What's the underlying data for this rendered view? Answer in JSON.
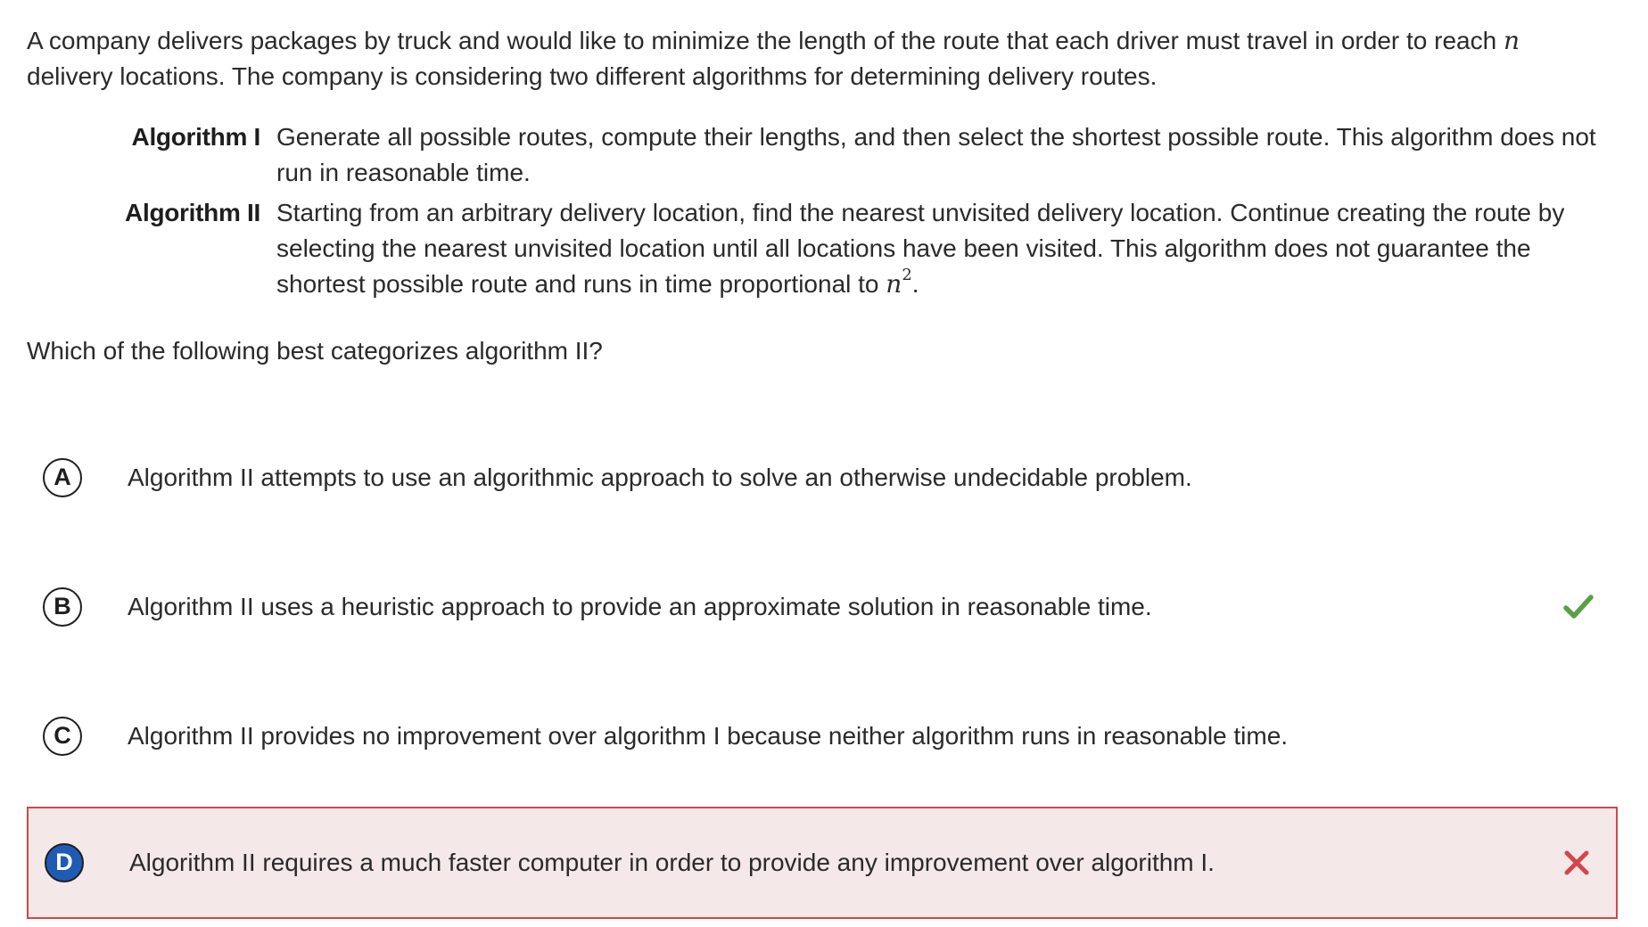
{
  "stem": {
    "line1_before": "A company delivers packages by truck and would like to minimize the length of the route that each driver must travel in order to reach ",
    "var_n": "n",
    "line2": "delivery locations. The company is considering two different algorithms for determining delivery routes."
  },
  "algorithms": [
    {
      "name": "Algorithm I",
      "description": "Generate all possible routes, compute their lengths, and then select the shortest possible route. This algorithm does not run in reasonable time."
    },
    {
      "name": "Algorithm II",
      "description": "Starting from an arbitrary delivery location, find the nearest unvisited delivery location. Continue creating the route by selecting the nearest unvisited location until all locations have been visited. This algorithm does not guarantee the shortest possible route and runs in time proportional to ",
      "math_base": "n",
      "math_exp": "2",
      "end": "."
    }
  ],
  "question": "Which of the following best categorizes algorithm II?",
  "choices": [
    {
      "letter": "A",
      "text": "Algorithm II attempts to use an algorithmic approach to solve an otherwise undecidable problem.",
      "status": "none"
    },
    {
      "letter": "B",
      "text": "Algorithm II uses a heuristic approach to provide an approximate solution in reasonable time.",
      "status": "correct",
      "icon": "checkmark-icon"
    },
    {
      "letter": "C",
      "text": "Algorithm II provides no improvement over algorithm I because neither algorithm runs in reasonable time.",
      "status": "none"
    },
    {
      "letter": "D",
      "text": "Algorithm II requires a much faster computer in order to provide any improvement over algorithm I.",
      "status": "incorrect-selected",
      "icon": "x-mark-icon"
    }
  ],
  "colors": {
    "correct": "#5aa046",
    "incorrect": "#d0474d",
    "selected_badge": "#1f5bb5",
    "incorrect_background": "#f5e8e8"
  }
}
